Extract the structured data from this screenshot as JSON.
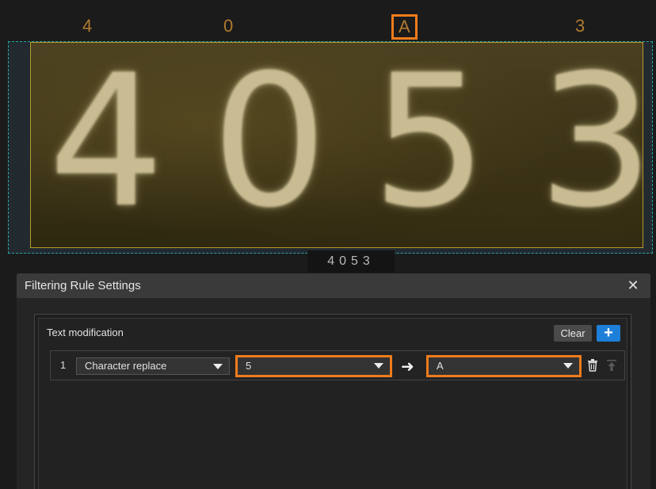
{
  "char_labels": [
    "4",
    "0",
    "A",
    "3"
  ],
  "highlighted_char_index": 2,
  "image_digits": [
    "4",
    "0",
    "5",
    "3"
  ],
  "recognition_result": "4053",
  "dialog": {
    "title": "Filtering Rule Settings",
    "close_label": "✕"
  },
  "panel": {
    "section_title": "Text modification",
    "clear_label": "Clear",
    "add_label": "+"
  },
  "rules": [
    {
      "index": "1",
      "type": "Character replace",
      "from": "5",
      "to": "A"
    }
  ],
  "colors": {
    "highlight": "#f07c1c",
    "accent": "#1e7fd8",
    "char_label": "#b07a2e",
    "roi_border": "#2aa6a6"
  },
  "icons": {
    "arrow": "arrow-right-icon",
    "delete": "trash-icon",
    "move_top": "move-to-top-icon"
  }
}
